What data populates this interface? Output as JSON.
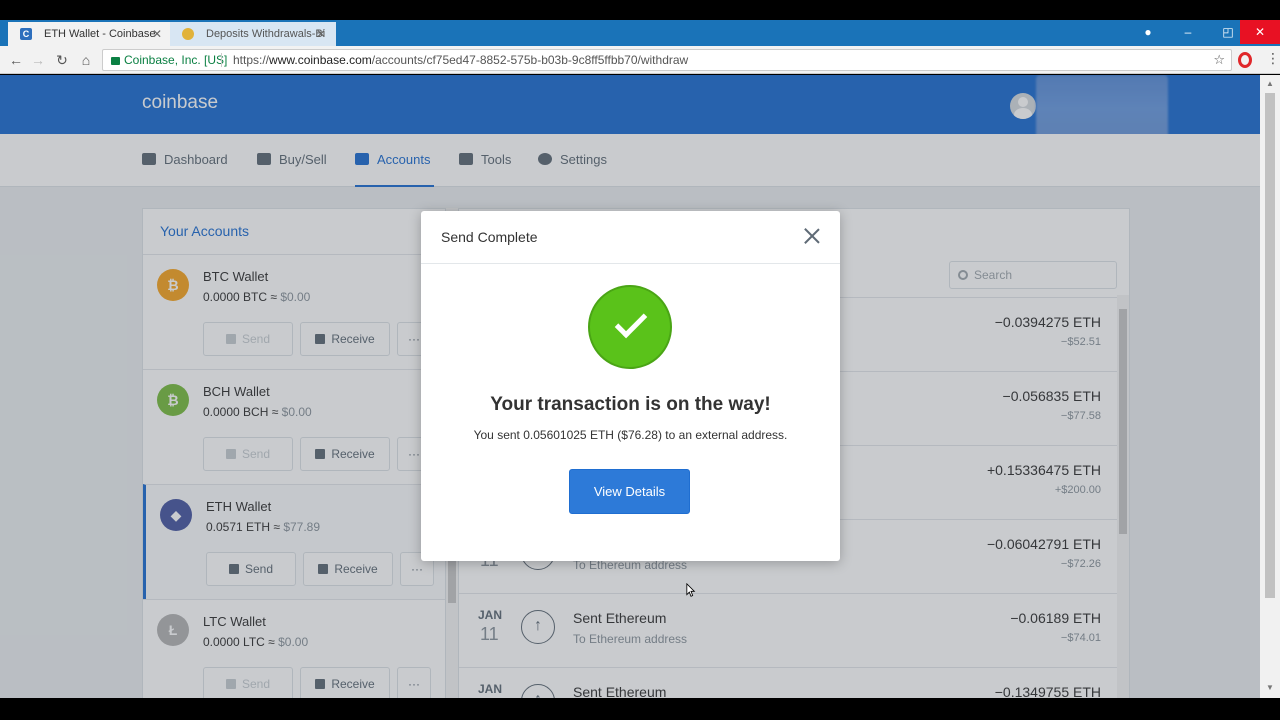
{
  "browser": {
    "tabs": [
      {
        "title": "ETH Wallet - Coinbase",
        "favicon": "C",
        "active": true
      },
      {
        "title": "Deposits Withdrawals-Bi",
        "favicon": "",
        "active": false
      }
    ],
    "security_label": "Coinbase, Inc. [US]",
    "url_prefix": "https://",
    "url_host": "www.coinbase.com",
    "url_path": "/accounts/cf75ed47-8852-575b-b03b-9c8ff5ffbb70/withdraw",
    "window_controls": {
      "minimize": "–",
      "restore": "◰",
      "close": "✕"
    }
  },
  "header": {
    "logo": "coinbase"
  },
  "nav": {
    "items": [
      {
        "label": "Dashboard",
        "icon": "dashboard-icon"
      },
      {
        "label": "Buy/Sell",
        "icon": "buy-sell-icon"
      },
      {
        "label": "Accounts",
        "icon": "wallet-icon",
        "active": true
      },
      {
        "label": "Tools",
        "icon": "tools-icon"
      },
      {
        "label": "Settings",
        "icon": "gear-icon"
      }
    ]
  },
  "accounts": {
    "title": "Your Accounts",
    "items": [
      {
        "name": "BTC Wallet",
        "balance": "0.0000 BTC",
        "approx": "≈",
        "fiat": "$0.00",
        "coin_symbol": "₿",
        "color": "#f7a623",
        "send": "Send",
        "receive": "Receive",
        "more": "···"
      },
      {
        "name": "BCH Wallet",
        "balance": "0.0000 BCH",
        "approx": "≈",
        "fiat": "$0.00",
        "coin_symbol": "₿",
        "color": "#7bbd42",
        "send": "Send",
        "receive": "Receive",
        "more": "···"
      },
      {
        "name": "ETH Wallet",
        "balance": "0.0571 ETH",
        "approx": "≈",
        "fiat": "$77.89",
        "coin_symbol": "◆",
        "color": "#4a59a2",
        "send": "Send",
        "receive": "Receive",
        "more": "···"
      },
      {
        "name": "LTC Wallet",
        "balance": "0.0000 LTC",
        "approx": "≈",
        "fiat": "$0.00",
        "coin_symbol": "Ł",
        "color": "#b5b5b5",
        "send": "Send",
        "receive": "Receive",
        "more": "···"
      }
    ]
  },
  "transactions": {
    "search_placeholder": "Search",
    "rows": [
      {
        "month": "",
        "day": "",
        "desc": "",
        "sub": "",
        "amount": "−0.0394275 ETH",
        "fiat": "−$52.51"
      },
      {
        "month": "",
        "day": "",
        "desc": "",
        "sub": "",
        "amount": "−0.056835 ETH",
        "fiat": "−$77.58"
      },
      {
        "month": "",
        "day": "",
        "desc": "",
        "sub": "",
        "amount": "+0.15336475 ETH",
        "fiat": "+$200.00"
      },
      {
        "month": "",
        "day": "11",
        "desc": "",
        "sub": "To Ethereum address",
        "amount": "−0.06042791 ETH",
        "fiat": "−$72.26"
      },
      {
        "month": "JAN",
        "day": "11",
        "desc": "Sent Ethereum",
        "sub": "To Ethereum address",
        "amount": "−0.06189 ETH",
        "fiat": "−$74.01"
      },
      {
        "month": "JAN",
        "day": "",
        "desc": "Sent Ethereum",
        "sub": "",
        "amount": "−0.1349755 ETH",
        "fiat": ""
      }
    ]
  },
  "modal": {
    "title": "Send Complete",
    "headline": "Your transaction is on the way!",
    "message": "You sent 0.05601025 ETH ($76.28) to an external address.",
    "button": "View Details"
  }
}
